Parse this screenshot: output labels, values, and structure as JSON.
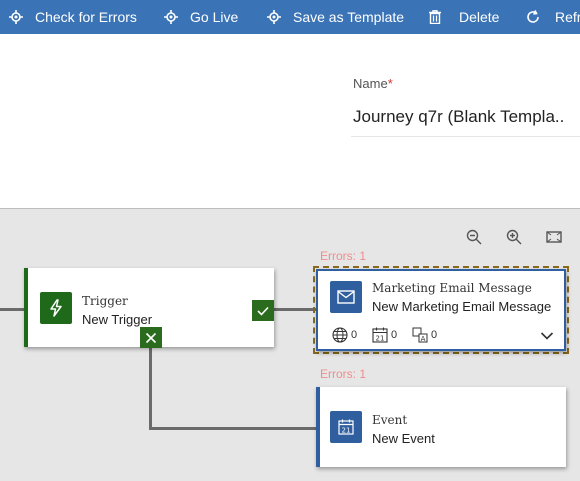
{
  "toolbar": {
    "check_errors": "Check for Errors",
    "go_live": "Go Live",
    "save_template": "Save as Template",
    "delete": "Delete",
    "refresh": "Refresh"
  },
  "form": {
    "name_label": "Name",
    "required_marker": "*",
    "name_value": "Journey q7r (Blank Templa..."
  },
  "canvas": {
    "zoom_controls": [
      "zoom-out-icon",
      "zoom-in-icon",
      "fit-to-screen-icon"
    ],
    "tiles": {
      "trigger": {
        "type": "Trigger",
        "name": "New Trigger",
        "icon": "lightning-icon",
        "color": "#1f6a1a"
      },
      "email": {
        "errors": "Errors: 1",
        "type": "Marketing Email Message",
        "name": "New Marketing Email Message",
        "icon": "envelope-icon",
        "stats": {
          "globe": "0",
          "calendar": "0",
          "translate": "0"
        }
      },
      "event": {
        "errors": "Errors: 1",
        "type": "Event",
        "name": "New Event",
        "icon": "calendar-icon"
      }
    }
  },
  "colors": {
    "toolbar": "#3a73b6",
    "accent_blue": "#2f5f9e",
    "trigger_green": "#1f6a1a",
    "error_text": "#f08c8c",
    "canvas_bg": "#e6e6e6",
    "selection_outline": "#8a6a1a"
  }
}
